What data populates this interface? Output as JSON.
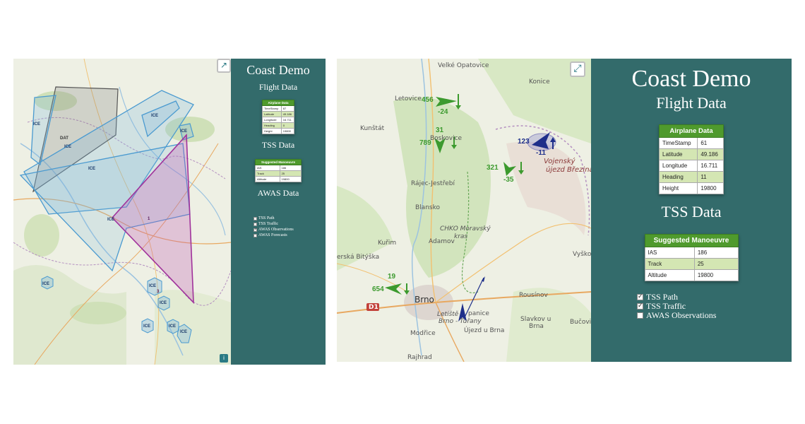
{
  "colors": {
    "sidebar_bg": "#336b6b",
    "table_header": "#4f9a2d",
    "table_even_row": "#d4e6b3",
    "traffic_green": "#3c9a2e",
    "ownship_navy": "#1e2f8a",
    "ice_zone_blue": "#4a9ad0",
    "restricted_purple": "#a0329b"
  },
  "left_view": {
    "fullscreen_icon": "↗",
    "info_icon": "i",
    "sidebar": {
      "title": "Coast Demo",
      "flight_data_heading": "Flight Data",
      "airplane_table": {
        "header": "Airplane Data",
        "rows": [
          {
            "label": "TimeStamp",
            "value": "87"
          },
          {
            "label": "Latitude",
            "value": "49.186"
          },
          {
            "label": "Longitude",
            "value": "16.711"
          },
          {
            "label": "Heading",
            "value": "0"
          },
          {
            "label": "Height",
            "value": "19800"
          }
        ]
      },
      "tss_heading": "TSS Data",
      "manoeuvre_table": {
        "header": "Suggested Manoeuvre",
        "rows": [
          {
            "label": "IAS",
            "value": "186"
          },
          {
            "label": "Track",
            "value": "25"
          },
          {
            "label": "Altitude",
            "value": "19800"
          }
        ]
      },
      "awas_heading": "AWAS Data",
      "layers": [
        {
          "label": "TSS Path",
          "checked": false
        },
        {
          "label": "TSS Traffic",
          "checked": false
        },
        {
          "label": "AWAS Observations",
          "checked": true
        },
        {
          "label": "AWAS Forecasts",
          "checked": false
        }
      ]
    },
    "map_markers": {
      "ice_label": "ICE",
      "dat_label": "DAT",
      "purple_marker": "1",
      "purple_marker_2": "3"
    }
  },
  "right_view": {
    "fullscreen_icon": "⤢",
    "sidebar": {
      "title": "Coast Demo",
      "flight_data_heading": "Flight Data",
      "airplane_table": {
        "header": "Airplane Data",
        "rows": [
          {
            "label": "TimeStamp",
            "value": "61"
          },
          {
            "label": "Latitude",
            "value": "49.186"
          },
          {
            "label": "Longitude",
            "value": "16.711"
          },
          {
            "label": "Heading",
            "value": "11"
          },
          {
            "label": "Height",
            "value": "19800"
          }
        ]
      },
      "tss_heading": "TSS Data",
      "manoeuvre_table": {
        "header": "Suggested Manoeuvre",
        "rows": [
          {
            "label": "IAS",
            "value": "186"
          },
          {
            "label": "Track",
            "value": "25"
          },
          {
            "label": "Altitude",
            "value": "19800"
          }
        ]
      },
      "layers": [
        {
          "label": "TSS Path",
          "checked": true
        },
        {
          "label": "TSS Traffic",
          "checked": true
        },
        {
          "label": "AWAS Observations",
          "checked": false
        }
      ]
    },
    "traffic": [
      {
        "id": "456",
        "offset": "-24"
      },
      {
        "id": "31",
        "offset": ""
      },
      {
        "id": "789",
        "offset": ""
      },
      {
        "id": "321",
        "offset": "-35"
      },
      {
        "id": "123",
        "offset": "-11"
      },
      {
        "id": "19",
        "offset": ""
      },
      {
        "id": "654",
        "offset": ""
      }
    ],
    "place_names": {
      "velke_opatovice": "Velké Opatovice",
      "konice": "Konice",
      "letovice": "Letovice",
      "kunstat": "Kunštát",
      "boskovice": "Boskovice",
      "vojensky": "Vojenský",
      "ujezd_brezina": "újezd Březina",
      "rajec": "Rájec-Jestřebí",
      "blansko": "Blansko",
      "chko": "CHKO Moravský",
      "kras": "kras",
      "adamov": "Adamov",
      "kurim": "Kuřim",
      "bityska": "erská Bitýška",
      "vyskov": "Vyško",
      "brno": "Brno",
      "rousinov": "Rousínov",
      "slavkov": "Slavkov u",
      "slavkov_brna": "Brna",
      "bucovice": "Bučovice",
      "modrice": "Modřice",
      "ujezd_brna": "Újezd u Brna",
      "letiste": "Letiště",
      "turany": "Brno - Tuřany",
      "rajhrad": "Rajhrad",
      "d1": "D1",
      "tupanice": "panice"
    }
  }
}
